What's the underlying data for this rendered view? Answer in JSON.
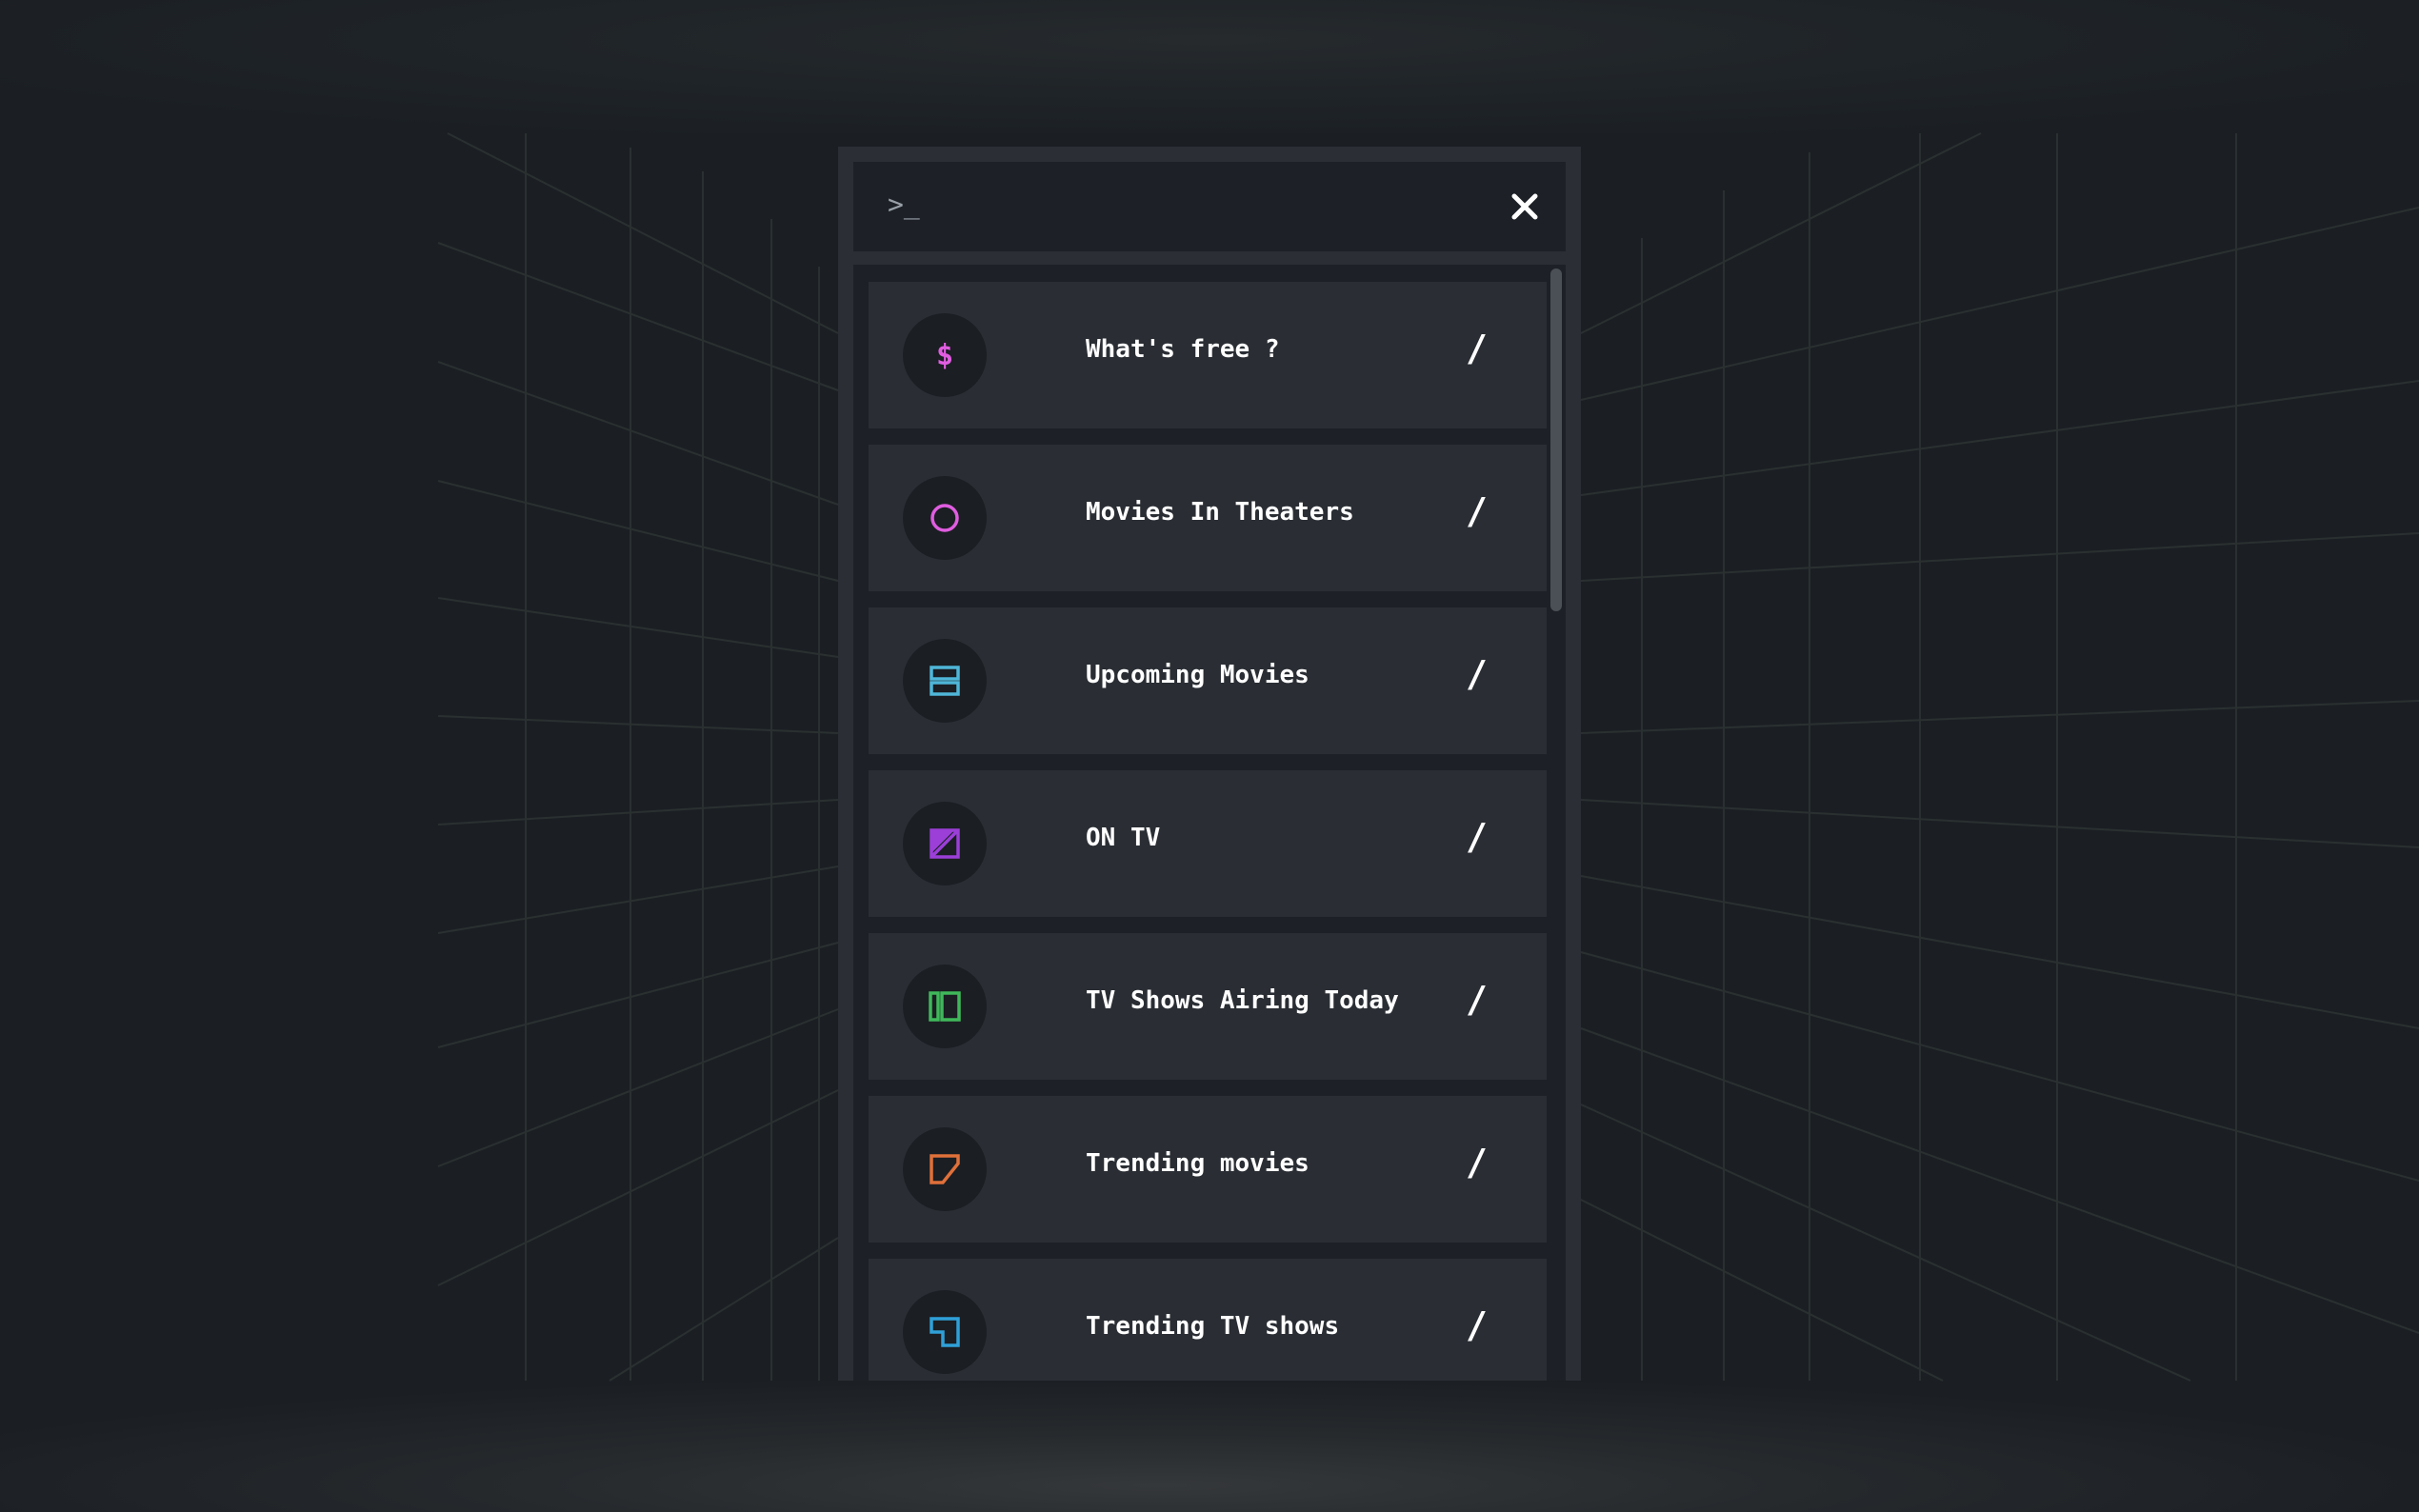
{
  "search": {
    "prompt": ">_",
    "value": "",
    "placeholder": ""
  },
  "menu": {
    "items": [
      {
        "label": "What's free ?",
        "icon": "dollar-icon",
        "color": "#e05de0",
        "arrow": "/"
      },
      {
        "label": "Movies In Theaters",
        "icon": "circle-icon",
        "color": "#e05de0",
        "arrow": "/"
      },
      {
        "label": "Upcoming Movies",
        "icon": "stacked-rectangles-icon",
        "color": "#4fb6d8",
        "arrow": "/"
      },
      {
        "label": "ON TV",
        "icon": "square-diagonal-icon",
        "color": "#9b3fd8",
        "arrow": "/"
      },
      {
        "label": "TV Shows Airing Today",
        "icon": "columns-icon",
        "color": "#3fb85a",
        "arrow": "/"
      },
      {
        "label": "Trending movies",
        "icon": "flag-shape-icon",
        "color": "#e0703a",
        "arrow": "/"
      },
      {
        "label": "Trending TV shows",
        "icon": "corner-square-icon",
        "color": "#2fa0d8",
        "arrow": "/"
      }
    ]
  }
}
